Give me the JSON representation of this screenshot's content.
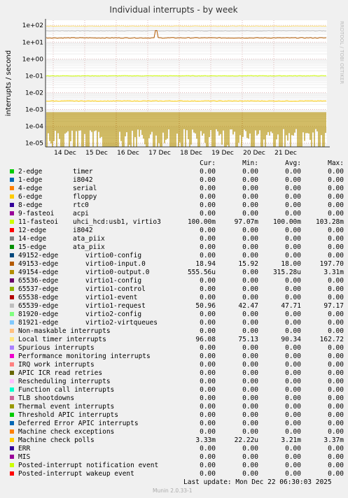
{
  "chart_data": {
    "type": "line",
    "title": "Individual interrupts - by week",
    "ylabel": "interrupts / second",
    "yscale": "log",
    "ylim": [
      6e-06,
      200
    ],
    "yticks": [
      "1e+02",
      "1e+01",
      "1e+00",
      "1e-01",
      "1e-02",
      "1e-03",
      "1e-04",
      "1e-05"
    ],
    "xticks": [
      "14 Dec",
      "15 Dec",
      "16 Dec",
      "17 Dec",
      "18 Dec",
      "19 Dec",
      "20 Dec",
      "21 Dec"
    ],
    "side_label": "RRDTOOL / TOBI OETIKER",
    "grid": true,
    "columns": [
      "Cur:",
      "Min:",
      "Avg:",
      "Max:"
    ],
    "series": [
      {
        "name": "2-edge",
        "desc": "timer",
        "color": "#00cc00",
        "cur": "0.00",
        "min": "0.00",
        "avg": "0.00",
        "max": "0.00"
      },
      {
        "name": "1-edge",
        "desc": "i8042",
        "color": "#0066b3",
        "cur": "0.00",
        "min": "0.00",
        "avg": "0.00",
        "max": "0.00"
      },
      {
        "name": "4-edge",
        "desc": "serial",
        "color": "#ff8000",
        "cur": "0.00",
        "min": "0.00",
        "avg": "0.00",
        "max": "0.00"
      },
      {
        "name": "6-edge",
        "desc": "floppy",
        "color": "#ffcc00",
        "cur": "0.00",
        "min": "0.00",
        "avg": "0.00",
        "max": "0.00"
      },
      {
        "name": "8-edge",
        "desc": "rtc0",
        "color": "#330099",
        "cur": "0.00",
        "min": "0.00",
        "avg": "0.00",
        "max": "0.00"
      },
      {
        "name": "9-fasteoi",
        "desc": "acpi",
        "color": "#990099",
        "cur": "0.00",
        "min": "0.00",
        "avg": "0.00",
        "max": "0.00"
      },
      {
        "name": "11-fasteoi",
        "desc": "uhci_hcd:usb1, virtio3",
        "color": "#ccff00",
        "cur": "100.00m",
        "min": "97.07m",
        "avg": "100.00m",
        "max": "103.28m"
      },
      {
        "name": "12-edge",
        "desc": "i8042",
        "color": "#ff0000",
        "cur": "0.00",
        "min": "0.00",
        "avg": "0.00",
        "max": "0.00"
      },
      {
        "name": "14-edge",
        "desc": "ata_piix",
        "color": "#808080",
        "cur": "0.00",
        "min": "0.00",
        "avg": "0.00",
        "max": "0.00"
      },
      {
        "name": "15-edge",
        "desc": "ata_piix",
        "color": "#008f00",
        "cur": "0.00",
        "min": "0.00",
        "avg": "0.00",
        "max": "0.00"
      },
      {
        "name": "49152-edge",
        "desc": "virtio0-config",
        "color": "#00487d",
        "cur": "0.00",
        "min": "0.00",
        "avg": "0.00",
        "max": "0.00"
      },
      {
        "name": "49153-edge",
        "desc": "virtio0-input.0",
        "color": "#b35a00",
        "cur": "18.94",
        "min": "15.92",
        "avg": "18.00",
        "max": "197.70"
      },
      {
        "name": "49154-edge",
        "desc": "virtio0-output.0",
        "color": "#b38f00",
        "cur": "555.56u",
        "min": "0.00",
        "avg": "315.28u",
        "max": "3.31m"
      },
      {
        "name": "65536-edge",
        "desc": "virtio1-config",
        "color": "#6b006b",
        "cur": "0.00",
        "min": "0.00",
        "avg": "0.00",
        "max": "0.00"
      },
      {
        "name": "65537-edge",
        "desc": "virtio1-control",
        "color": "#8fb300",
        "cur": "0.00",
        "min": "0.00",
        "avg": "0.00",
        "max": "0.00"
      },
      {
        "name": "65538-edge",
        "desc": "virtio1-event",
        "color": "#b30000",
        "cur": "0.00",
        "min": "0.00",
        "avg": "0.00",
        "max": "0.00"
      },
      {
        "name": "65539-edge",
        "desc": "virtio1-request",
        "color": "#bebebe",
        "cur": "50.96",
        "min": "42.47",
        "avg": "47.71",
        "max": "97.17"
      },
      {
        "name": "81920-edge",
        "desc": "virtio2-config",
        "color": "#80ff80",
        "cur": "0.00",
        "min": "0.00",
        "avg": "0.00",
        "max": "0.00"
      },
      {
        "name": "81921-edge",
        "desc": "virtio2-virtqueues",
        "color": "#80c9ff",
        "cur": "0.00",
        "min": "0.00",
        "avg": "0.00",
        "max": "0.00"
      },
      {
        "name": "Non-maskable interrupts",
        "desc": "",
        "color": "#ffc080",
        "cur": "0.00",
        "min": "0.00",
        "avg": "0.00",
        "max": "0.00"
      },
      {
        "name": "Local timer interrupts",
        "desc": "",
        "color": "#ffe680",
        "cur": "96.08",
        "min": "75.13",
        "avg": "90.34",
        "max": "162.72"
      },
      {
        "name": "Spurious interrupts",
        "desc": "",
        "color": "#aa80ff",
        "cur": "0.00",
        "min": "0.00",
        "avg": "0.00",
        "max": "0.00"
      },
      {
        "name": "Performance monitoring interrupts",
        "desc": "",
        "color": "#ee00cc",
        "cur": "0.00",
        "min": "0.00",
        "avg": "0.00",
        "max": "0.00"
      },
      {
        "name": "IRQ work interrupts",
        "desc": "",
        "color": "#ff8080",
        "cur": "0.00",
        "min": "0.00",
        "avg": "0.00",
        "max": "0.00"
      },
      {
        "name": "APIC ICR read retries",
        "desc": "",
        "color": "#666600",
        "cur": "0.00",
        "min": "0.00",
        "avg": "0.00",
        "max": "0.00"
      },
      {
        "name": "Rescheduling interrupts",
        "desc": "",
        "color": "#ffbfff",
        "cur": "0.00",
        "min": "0.00",
        "avg": "0.00",
        "max": "0.00"
      },
      {
        "name": "Function call interrupts",
        "desc": "",
        "color": "#00ffcc",
        "cur": "0.00",
        "min": "0.00",
        "avg": "0.00",
        "max": "0.00"
      },
      {
        "name": "TLB shootdowns",
        "desc": "",
        "color": "#cc6699",
        "cur": "0.00",
        "min": "0.00",
        "avg": "0.00",
        "max": "0.00"
      },
      {
        "name": "Thermal event interrupts",
        "desc": "",
        "color": "#999900",
        "cur": "0.00",
        "min": "0.00",
        "avg": "0.00",
        "max": "0.00"
      },
      {
        "name": "Threshold APIC interrupts",
        "desc": "",
        "color": "#00cc00",
        "cur": "0.00",
        "min": "0.00",
        "avg": "0.00",
        "max": "0.00"
      },
      {
        "name": "Deferred Error APIC interrupts",
        "desc": "",
        "color": "#0066b3",
        "cur": "0.00",
        "min": "0.00",
        "avg": "0.00",
        "max": "0.00"
      },
      {
        "name": "Machine check exceptions",
        "desc": "",
        "color": "#ff8000",
        "cur": "0.00",
        "min": "0.00",
        "avg": "0.00",
        "max": "0.00"
      },
      {
        "name": "Machine check polls",
        "desc": "",
        "color": "#ffcc00",
        "cur": "3.33m",
        "min": "22.22u",
        "avg": "3.21m",
        "max": "3.37m"
      },
      {
        "name": "ERR",
        "desc": "",
        "color": "#330099",
        "cur": "0.00",
        "min": "0.00",
        "avg": "0.00",
        "max": "0.00"
      },
      {
        "name": "MIS",
        "desc": "",
        "color": "#990099",
        "cur": "0.00",
        "min": "0.00",
        "avg": "0.00",
        "max": "0.00"
      },
      {
        "name": "Posted-interrupt notification event",
        "desc": "",
        "color": "#ccff00",
        "cur": "0.00",
        "min": "0.00",
        "avg": "0.00",
        "max": "0.00"
      },
      {
        "name": "Posted-interrupt wakeup event",
        "desc": "",
        "color": "#ff0000",
        "cur": "0.00",
        "min": "0.00",
        "avg": "0.00",
        "max": "0.00"
      }
    ]
  },
  "footer": {
    "last_update": "Last update:  Mon Dec 22 06:30:03 2025",
    "munin_version": "Munin 2.0.33-1"
  }
}
